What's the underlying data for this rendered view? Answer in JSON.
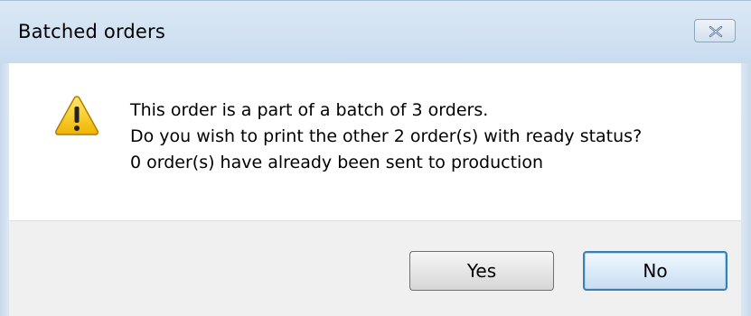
{
  "window": {
    "title": "Batched orders",
    "close_icon": "close-icon"
  },
  "message": {
    "icon": "warning-icon",
    "lines": [
      "This order is a part of a batch of 3 orders.",
      "Do you wish to print the other 2 order(s) with ready status?",
      "0 order(s) have already been sent to production"
    ]
  },
  "buttons": {
    "yes_label": "Yes",
    "no_label": "No"
  },
  "colors": {
    "titlebar": "#c9dcef",
    "footer": "#f0f0f0",
    "default_button_border": "#3c7fb1",
    "warning_yellow": "#f5c400"
  }
}
